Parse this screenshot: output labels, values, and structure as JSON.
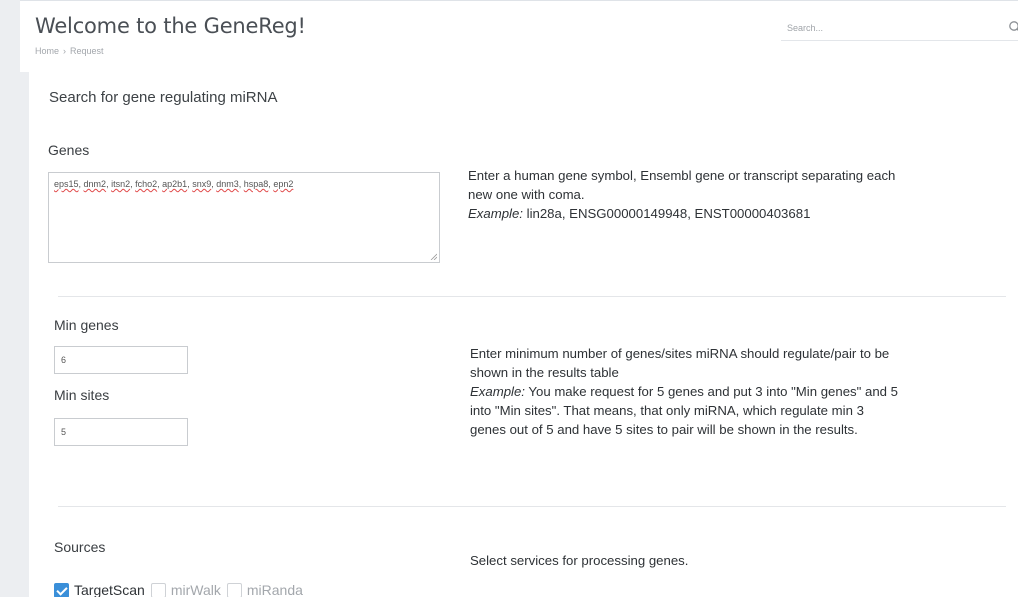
{
  "header": {
    "title": "Welcome to the GeneReg!",
    "breadcrumb": [
      "Home",
      "Request"
    ],
    "breadcrumb_sep": "›",
    "search_placeholder": "Search..."
  },
  "panel": {
    "title": "Search for gene regulating miRNA"
  },
  "genes": {
    "label": "Genes",
    "value": [
      "eps15",
      "dnm2",
      "itsn2",
      "fcho2",
      "ap2b1",
      "snx9",
      "dnm3",
      "hspa8",
      "epn2"
    ],
    "help_line1": "Enter a human gene symbol, Ensembl gene or transcript separating each",
    "help_line2": "new one with coma.",
    "help_example_label": "Example:",
    "help_example_value": " lin28a, ENSG00000149948, ENST00000403681"
  },
  "min_genes": {
    "label": "Min genes",
    "value": "6"
  },
  "min_sites": {
    "label": "Min sites",
    "value": "5"
  },
  "minimum_help": {
    "line1": "Enter minimum number of genes/sites miRNA should regulate/pair to be",
    "line2": "shown in the results table",
    "example_label": "Example:",
    "example_line1": " You make request for 5 genes and put 3 into \"Min genes\" and 5",
    "example_line2": "into \"Min sites\". That means, that only miRNA, which regulate min 3",
    "example_line3": "genes out of 5 and have 5 sites to pair will be shown in the results."
  },
  "sources": {
    "label": "Sources",
    "help": "Select services for processing genes.",
    "options": [
      {
        "label": "TargetScan",
        "checked": true
      },
      {
        "label": "mirWalk",
        "checked": false
      },
      {
        "label": "miRanda",
        "checked": false
      }
    ]
  },
  "colors": {
    "accent": "#3a8fd9",
    "page_bg": "#eceef1",
    "spell_underline": "#e04848"
  }
}
